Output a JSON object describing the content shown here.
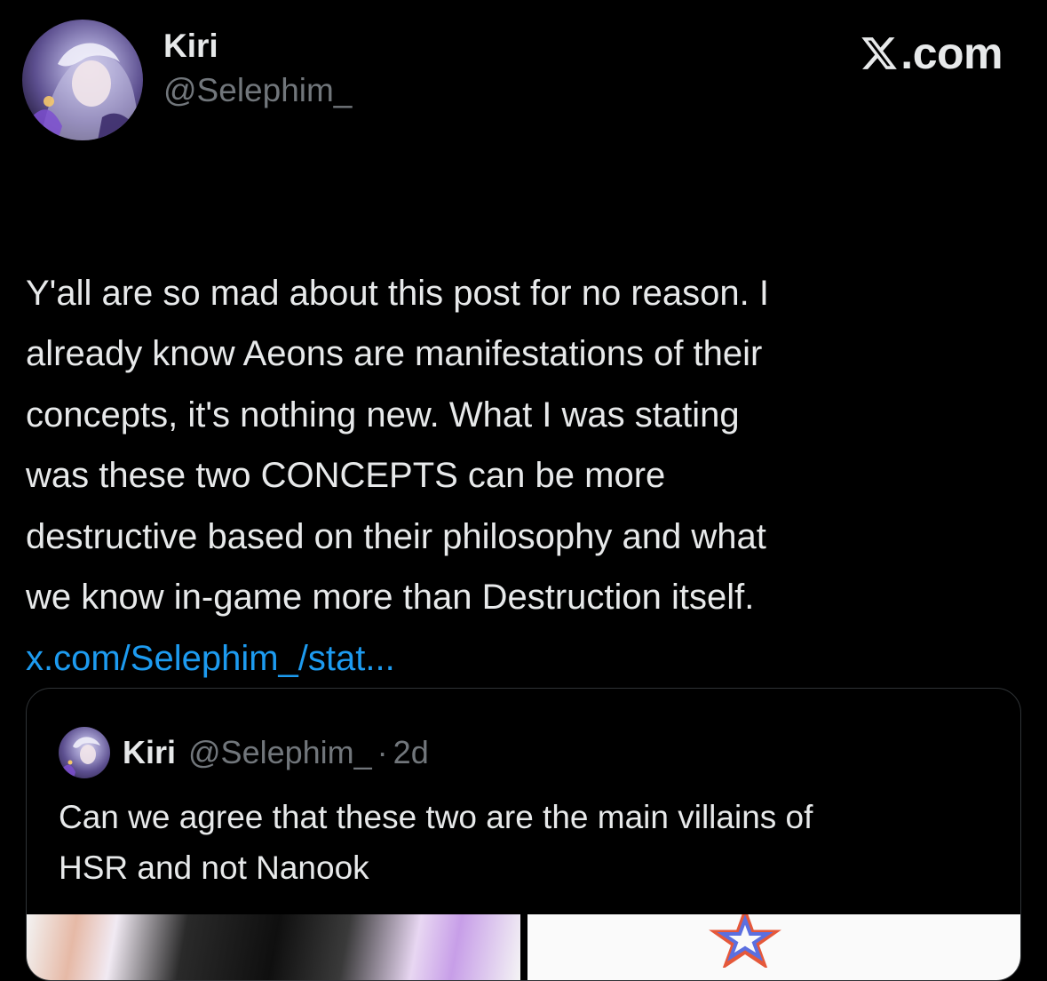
{
  "tweet": {
    "author_name": "Kiri",
    "author_handle": "@Selephim_",
    "avatar_icon": "avatar-icon",
    "brand_label": ".com",
    "brand_icon": "x-logo-icon",
    "text": "Y'all are so mad about this post for no reason. I\nalready know Aeons are manifestations of their\nconcepts, it's nothing new. What I was stating\nwas these two CONCEPTS can be more\ndestructive based on their philosophy and what\nwe know in-game more than Destruction itself.",
    "link_text": "x.com/Selephim_/stat...",
    "link_color": "#1d9bf0"
  },
  "quoted_tweet": {
    "author_name": "Kiri",
    "author_handle": "@Selephim_",
    "separator": "·",
    "time": "2d",
    "text": "Can we agree that these two are the main villains of\nHSR and not Nanook"
  },
  "colors": {
    "background": "#000000",
    "text_primary": "#e7e9ea",
    "text_secondary": "#71767b",
    "border": "#2f3336"
  }
}
